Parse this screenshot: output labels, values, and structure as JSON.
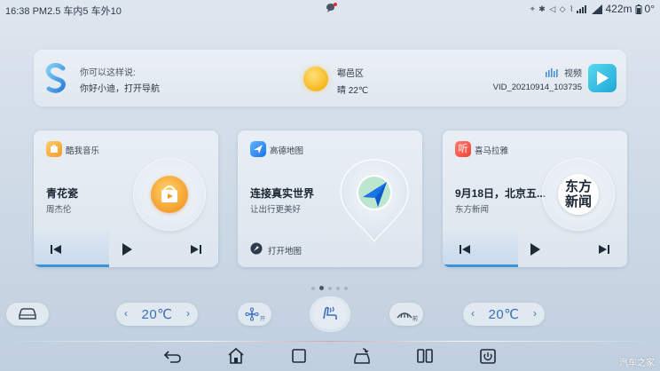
{
  "status_bar": {
    "left_text": "16:38 PM2.5 车内5 车外10",
    "mileage": "422m",
    "temp_icon_text": "0°"
  },
  "assistant": {
    "hint_title": "你可以这样说:",
    "hint_text": "你好小迪，打开导航"
  },
  "weather": {
    "location": "鄠邑区",
    "condition": "晴 22℃",
    "icon": "sun-icon"
  },
  "video": {
    "label": "视频",
    "filename": "VID_20210914_103735"
  },
  "cards": {
    "music": {
      "app_name": "酷我音乐",
      "title": "青花瓷",
      "subtitle": "周杰伦",
      "progress": 0.41
    },
    "map": {
      "app_name": "高德地图",
      "title": "连接真实世界",
      "subtitle": "让出行更美好",
      "action": "打开地图"
    },
    "radio": {
      "app_name": "喜马拉雅",
      "app_badge": "听",
      "title": "9月18日，北京五...",
      "subtitle": "东方新闻",
      "cover_text_1": "东方",
      "cover_text_2": "新闻",
      "progress": 0.41
    }
  },
  "pager": {
    "count": 5,
    "active": 1
  },
  "climate": {
    "left_temp": "20℃",
    "right_temp": "20℃",
    "fan_label": "开",
    "defrost_label": "前"
  },
  "accent_colors": {
    "primary": "#3b93d6",
    "temp": "#3a6ebd",
    "play": "#1fa7d8"
  },
  "watermark": "汽车之家"
}
